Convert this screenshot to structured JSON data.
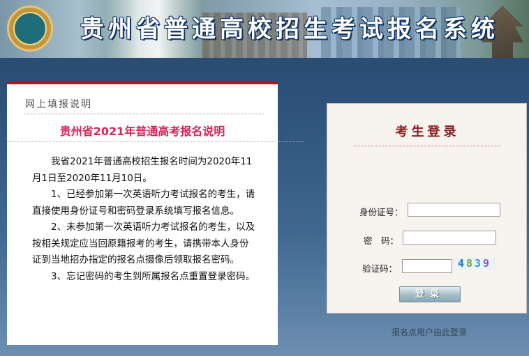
{
  "header": {
    "title": "贵州省普通高校招生考试报名系统",
    "logo_icon": "education-emblem-icon"
  },
  "notice": {
    "heading": "网上填报说明",
    "title": "贵州省2021年普通高考报名说明",
    "paragraphs": [
      "我省2021年普通高校招生报名时间为2020年11月1日至2020年11月10日。",
      "1、已经参加第一次英语听力考试报名的考生，请直接使用身份证号和密码登录系统填写报名信息。",
      "2、未参加第一次英语听力考试报名的考生，以及按相关规定应当回原籍报考的考生，请携带本人身份证到当地招办指定的报名点摄像后领取报名密码。",
      "3、忘记密码的考生到所属报名点重置登录密码。"
    ]
  },
  "login": {
    "title": "考生登录",
    "id_label": "身份证号：",
    "id_value": "",
    "password_label": "密　码：",
    "password_value": "",
    "captcha_label": "验证码：",
    "captcha_value": "",
    "captcha_image": [
      "4",
      "8",
      "3",
      "9"
    ],
    "submit_label": "登录"
  },
  "footer_link": "报名点用户由此登录",
  "colors": {
    "accent_red": "#b5121b",
    "title_pink": "#d7265a",
    "login_title": "#8a2020"
  }
}
